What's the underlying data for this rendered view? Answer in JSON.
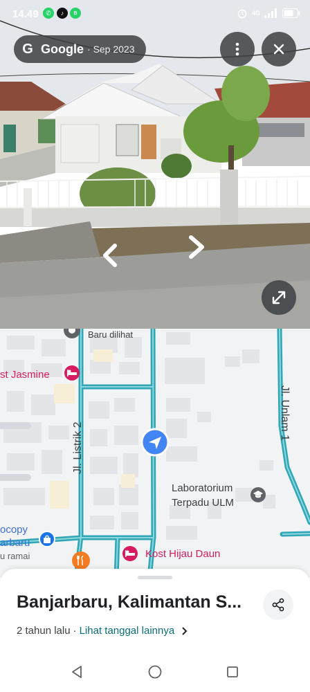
{
  "status_bar": {
    "time": "14.49",
    "network": "4G",
    "icons": [
      "whatsapp-icon",
      "tiktok-icon",
      "wa-business-icon",
      "alarm-icon",
      "signal-icon",
      "battery-icon"
    ]
  },
  "street_view": {
    "brand": "Google",
    "capture_date": "Sep 2023",
    "actions": [
      "more-vert-icon",
      "close-icon",
      "fullscreen-icon"
    ],
    "nav_arrows": [
      "arrow-left-icon",
      "arrow-right-icon"
    ]
  },
  "map": {
    "labels": {
      "recently_viewed": "Baru dilihat",
      "kost_jasmine": "st Jasmine",
      "jl_listrik": "Jl. Listrik 2",
      "jl_unlam": "Jl. Unlam 1",
      "lab_line1": "Laboratorium",
      "lab_line2": "Terpadu ULM",
      "fotocopy_line1": "ocopy",
      "fotocopy_line2": "arbaru",
      "fotocopy_line3": "u ramai",
      "kost_hijau": "Kost Hijau Daun"
    },
    "colors": {
      "road": "#2fa7b5",
      "building": "#e3e5e8",
      "poi_pink": "#d81b60",
      "location": "#4285f4"
    }
  },
  "sheet": {
    "title": "Banjarbaru, Kalimantan S...",
    "age": "2 tahun lalu",
    "separator": "·",
    "more_dates_link": "Lihat tanggal lainnya"
  },
  "nav_bar": {
    "buttons": [
      "back-icon",
      "home-icon",
      "recents-icon"
    ]
  }
}
